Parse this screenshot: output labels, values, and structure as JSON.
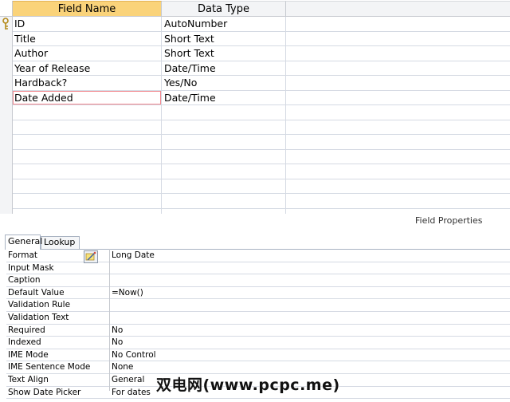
{
  "design": {
    "headers": {
      "field_name": "Field Name",
      "data_type": "Data Type"
    },
    "fields": [
      {
        "name": "ID",
        "type": "AutoNumber",
        "primary_key": true
      },
      {
        "name": "Title",
        "type": "Short Text"
      },
      {
        "name": "Author",
        "type": "Short Text"
      },
      {
        "name": "Year of Release",
        "type": "Date/Time"
      },
      {
        "name": "Hardback?",
        "type": "Yes/No"
      },
      {
        "name": "Date Added",
        "type": "Date/Time",
        "selected": true
      }
    ]
  },
  "properties": {
    "section_label": "Field Properties",
    "tabs": {
      "general": "General",
      "lookup": "Lookup"
    },
    "rows": [
      {
        "label": "Format",
        "value": "Long Date"
      },
      {
        "label": "Input Mask",
        "value": ""
      },
      {
        "label": "Caption",
        "value": ""
      },
      {
        "label": "Default Value",
        "value": "=Now()"
      },
      {
        "label": "Validation Rule",
        "value": ""
      },
      {
        "label": "Validation Text",
        "value": ""
      },
      {
        "label": "Required",
        "value": "No"
      },
      {
        "label": "Indexed",
        "value": "No"
      },
      {
        "label": "IME Mode",
        "value": "No Control"
      },
      {
        "label": "IME Sentence Mode",
        "value": "None"
      },
      {
        "label": "Text Align",
        "value": "General"
      },
      {
        "label": "Show Date Picker",
        "value": "For dates"
      }
    ]
  },
  "watermark": "双电网(www.pcpc.me)",
  "icons": {
    "primary_key": "key-icon",
    "builder": "builder-icon"
  },
  "colors": {
    "header_selected": "#fad37a",
    "selected_outline": "#f2888f"
  }
}
